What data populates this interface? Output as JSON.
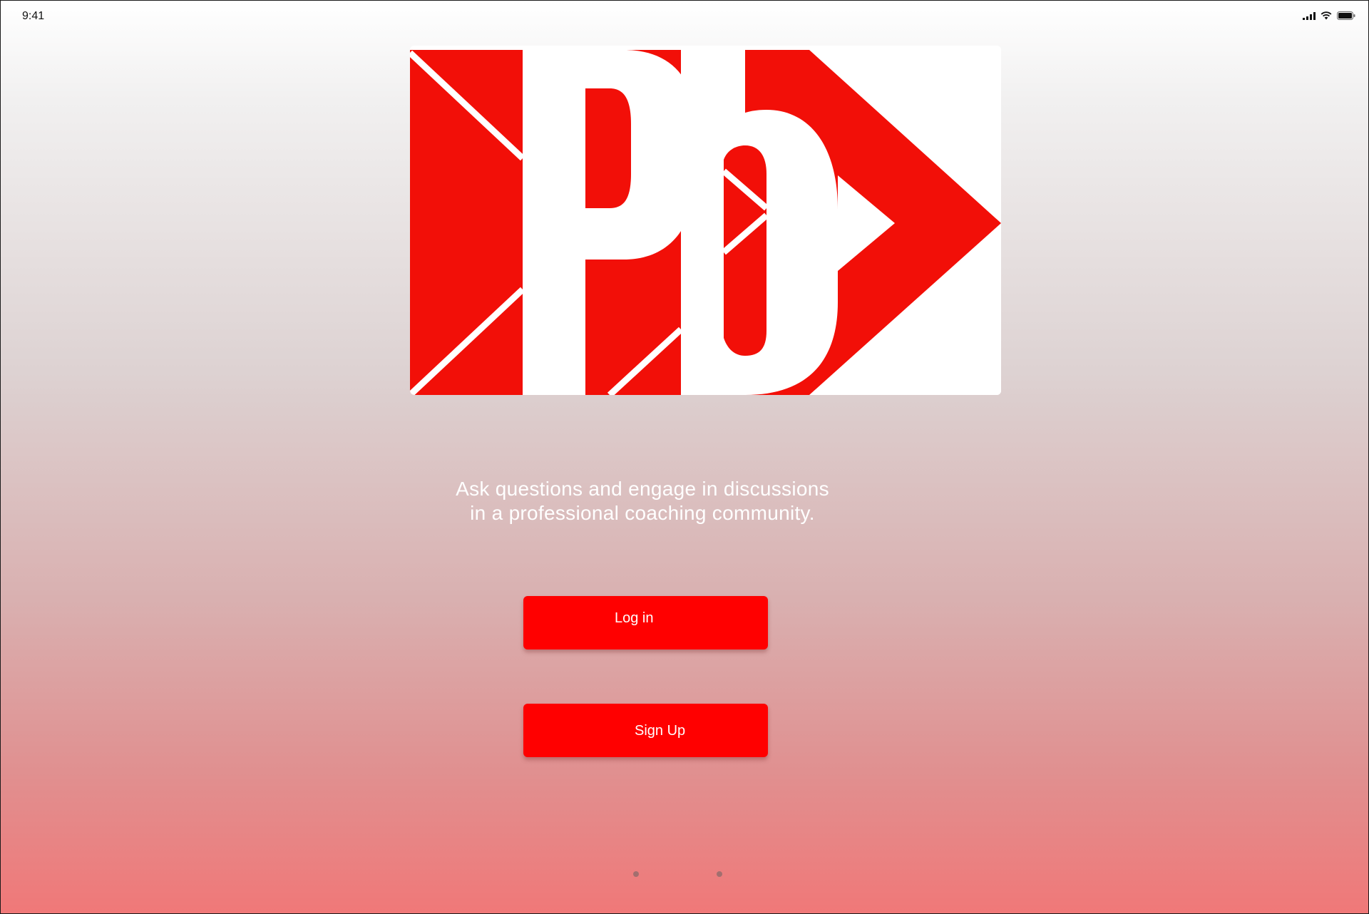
{
  "status_bar": {
    "time": "9:41",
    "icons": [
      "signal-icon",
      "wifi-icon",
      "battery-icon"
    ]
  },
  "logo": {
    "icon": "pb-logo-icon",
    "colors": {
      "red": "#F20F08",
      "white": "#FFFFFF"
    }
  },
  "tagline": {
    "line1": "Ask questions and engage in discussions",
    "line2": "in a professional coaching community."
  },
  "buttons": {
    "login_label": "Log in",
    "signup_label": "Sign Up",
    "color": "#FF0000"
  },
  "pager": {
    "dot_count": 2
  }
}
